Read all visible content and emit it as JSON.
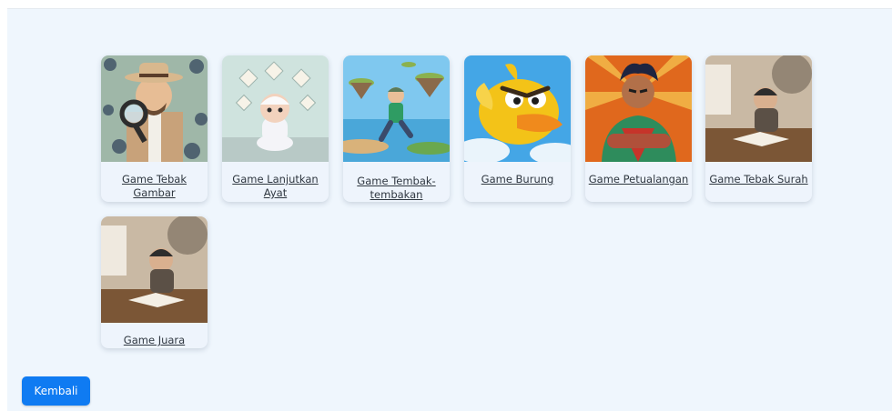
{
  "games": [
    {
      "label": "Game Tebak Gambar",
      "image": "detective-with-magnifier"
    },
    {
      "label": "Game Lanjutkan Ayat",
      "image": "child-praying"
    },
    {
      "label": "Game Tembak-tembakan",
      "image": "flying-islands-runner"
    },
    {
      "label": "Game Burung",
      "image": "angry-yellow-bird"
    },
    {
      "label": "Game Petualangan",
      "image": "muscular-hero"
    },
    {
      "label": "Game Tebak Surah",
      "image": "reader-at-desk"
    },
    {
      "label": "Game Juara",
      "image": "reader-at-desk"
    }
  ],
  "back_button": {
    "label": "Kembali"
  },
  "colors": {
    "accent": "#0f7bf2",
    "background": "#eff6fd"
  }
}
